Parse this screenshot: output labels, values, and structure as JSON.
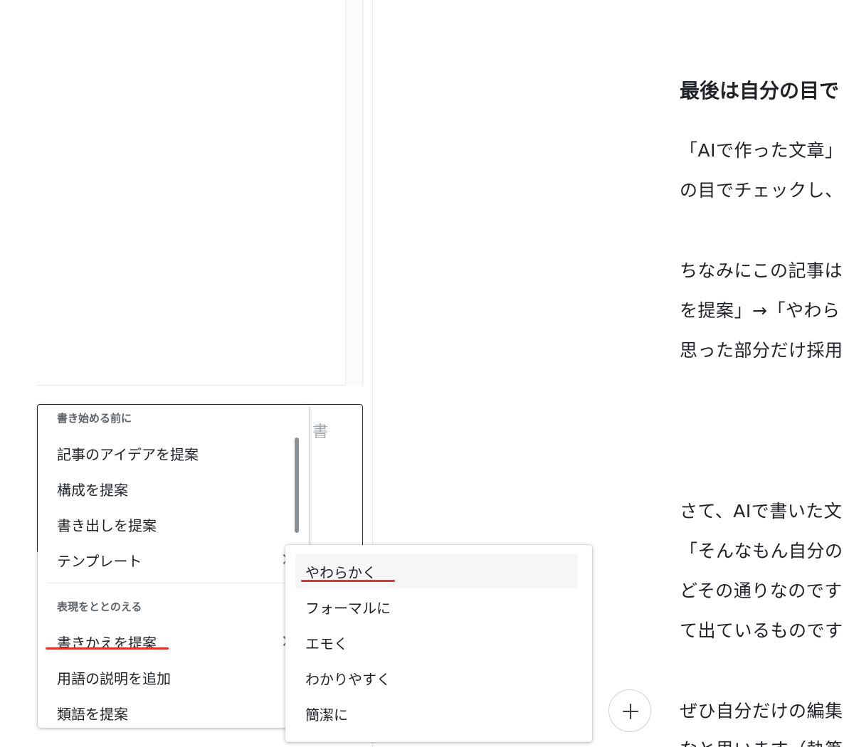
{
  "editor": {
    "textarea_placeholder": "書"
  },
  "menu": {
    "section_before": "書き始める前に",
    "items_before": [
      {
        "label": "記事のアイデアを提案"
      },
      {
        "label": "構成を提案"
      },
      {
        "label": "書き出しを提案"
      },
      {
        "label": "テンプレート"
      }
    ],
    "section_refine": "表現をととのえる",
    "items_refine": [
      {
        "label": "書きかえを提案"
      },
      {
        "label": "用語の説明を追加"
      },
      {
        "label": "類語を提案"
      }
    ]
  },
  "submenu": {
    "items": [
      {
        "label": "やわらかく"
      },
      {
        "label": "フォーマルに"
      },
      {
        "label": "エモく"
      },
      {
        "label": "わかりやすく"
      },
      {
        "label": "簡潔に"
      }
    ]
  },
  "article": {
    "heading": "最後は自分の目で",
    "lines": [
      "「AIで作った文章」",
      "の目でチェックし、",
      "ちなみにこの記事は",
      "を提案」→「やわら",
      "思った部分だけ採用",
      "さて、AIで書いた文",
      "「そんなもん自分の",
      "どその通りなのです",
      "て出ているものです",
      "ぜひ自分だけの編集",
      "なと思います（執筆"
    ]
  },
  "colors": {
    "annotation_underline": "#e5322d"
  }
}
